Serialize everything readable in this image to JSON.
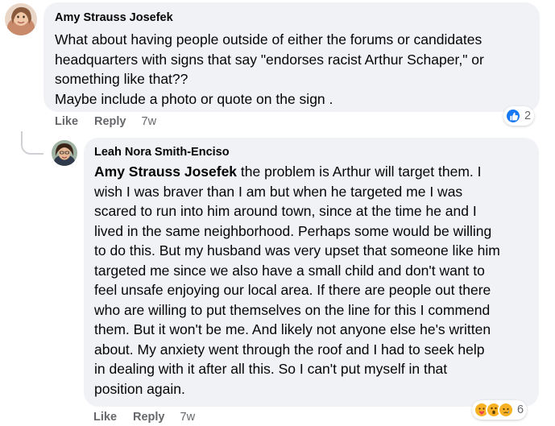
{
  "comment1": {
    "author": "Amy Strauss Josefek",
    "lines": [
      "What about having people outside of either the forums or candidates",
      "headquarters with signs that say \"endorses racist Arthur Schaper,\" or",
      "something like that??",
      "Maybe include a photo or quote on the sign ."
    ],
    "reaction_count": "2",
    "reaction_icons": [
      "like-icon"
    ],
    "like_label": "Like",
    "reply_label": "Reply",
    "time": "7w"
  },
  "comment2": {
    "author": "Leah Nora Smith-Enciso",
    "mention": "Amy Strauss Josefek",
    "lines": [
      " the problem is Arthur will target them. I",
      "wish I was braver than I am but when he targeted me I was",
      "scared to run into him around town, since at the time he and I",
      "lived in the same neighborhood. Perhaps some would be willing",
      "to do this. But my husband was very upset that someone like him",
      "targeted me since we also have a small child and don't want to",
      "feel unsafe enjoying our local area. If there are people out there",
      "who are willing to put themselves on the line for this I commend",
      "them. But it won't be me. And likely not anyone else he's written",
      "about. My anxiety went through the roof and I had to seek help",
      "in dealing with it after all this. So I can't put myself in that",
      "position again."
    ],
    "reaction_count": "6",
    "reaction_icons": [
      "care-icon",
      "wow-icon",
      "sad-icon"
    ],
    "like_label": "Like",
    "reply_label": "Reply",
    "time": "7w"
  },
  "colors": {
    "bubble": "#f0f2f5",
    "secondary_text": "#65676b",
    "like_blue": "#1877f2",
    "emoji_yellow": "#f7b125"
  }
}
